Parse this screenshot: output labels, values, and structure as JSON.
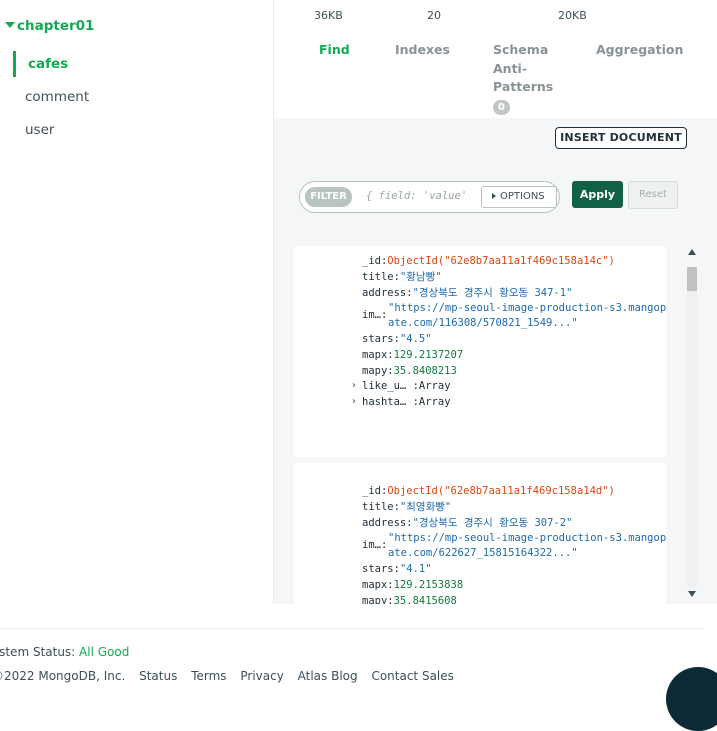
{
  "sidebar": {
    "database": "chapter01",
    "collections": [
      {
        "label": "cafes",
        "active": true
      },
      {
        "label": "comment",
        "active": false
      },
      {
        "label": "user",
        "active": false
      }
    ]
  },
  "stats": {
    "size": "36KB",
    "count": "20",
    "index_size": "20KB"
  },
  "tabs": [
    {
      "label": "Find",
      "active": true
    },
    {
      "label": "Indexes",
      "active": false
    },
    {
      "label": "Schema Anti-Patterns",
      "badge": "0",
      "active": false
    },
    {
      "label": "Aggregation",
      "active": false
    }
  ],
  "toolbar": {
    "insert_label": "INSERT DOCUMENT",
    "filter_label": "FILTER",
    "filter_placeholder": "{ field: 'value'",
    "options_label": "OPTIONS",
    "apply_label": "Apply",
    "reset_label": "Reset"
  },
  "documents": [
    {
      "_id_key": "_id:",
      "_id": "ObjectId(\"62e8b7aa11a1f469c158a14c\")",
      "title_key": "title:",
      "title": "\"황남빵\"",
      "address_key": "address:",
      "address": "\"경상북도 경주시 황오동 347-1\"",
      "image_key": "im…:",
      "image_line1": "\"https://mp-seoul-image-production-s3.mangopl",
      "image_line2": "ate.com/116308/570821_1549...\"",
      "stars_key": "stars:",
      "stars": "\"4.5\"",
      "mapx_key": "mapx:",
      "mapx": "129.2137207",
      "mapy_key": "mapy:",
      "mapy": "35.8408213",
      "like_key": "like_u… :",
      "like": "Array",
      "hashtag_key": "hashta… :",
      "hashtag": "Array"
    },
    {
      "_id_key": "_id:",
      "_id": "ObjectId(\"62e8b7aa11a1f469c158a14d\")",
      "title_key": "title:",
      "title": "\"최영화빵\"",
      "address_key": "address:",
      "address": "\"경상북도 경주시 황오동 307-2\"",
      "image_key": "im…:",
      "image_line1": "\"https://mp-seoul-image-production-s3.mangopl",
      "image_line2": "ate.com/622627_15815164322...\"",
      "stars_key": "stars:",
      "stars": "\"4.1\"",
      "mapx_key": "mapx:",
      "mapx": "129.2153838",
      "mapy_key": "mapy:",
      "mapy": "35.8415608"
    }
  ],
  "footer": {
    "system_status_label": "ystem Status: ",
    "system_status_value": "All Good",
    "copyright": "©2022 MongoDB, Inc.",
    "links": [
      "Status",
      "Terms",
      "Privacy",
      "Atlas Blog",
      "Contact Sales"
    ]
  }
}
